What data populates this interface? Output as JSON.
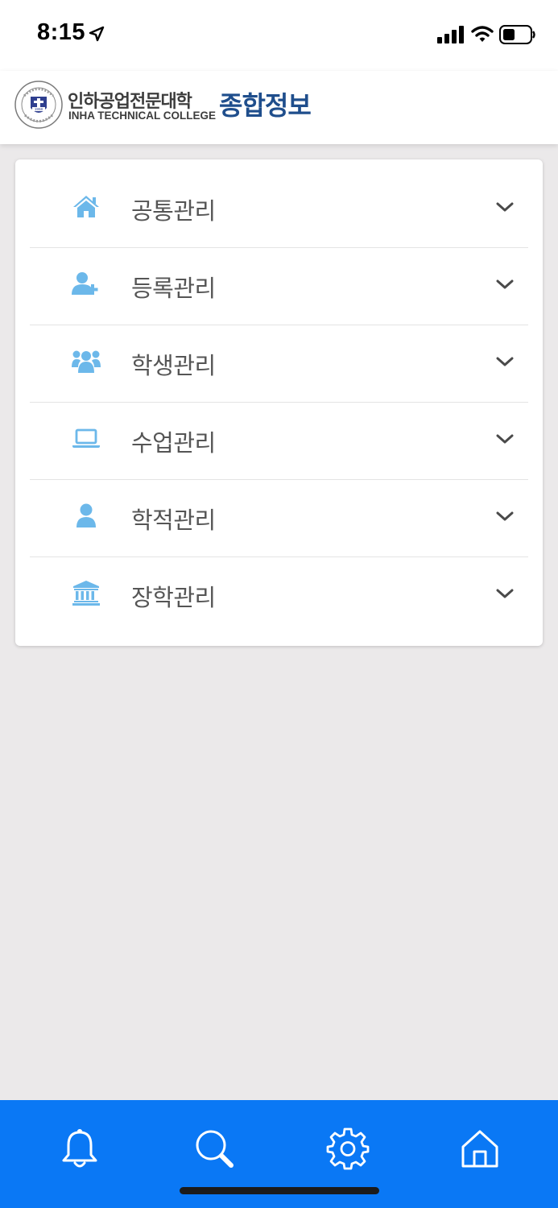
{
  "status_bar": {
    "time": "8:15",
    "icons": [
      "location-arrow-icon",
      "signal-icon",
      "wifi-icon",
      "battery-icon"
    ]
  },
  "header": {
    "logo_korean": "인하공업전문대학",
    "logo_english": "INHA TECHNICAL COLLEGE",
    "emblem_year": "1958",
    "title": "종합정보"
  },
  "menu": {
    "items": [
      {
        "label": "공통관리",
        "icon": "home-icon"
      },
      {
        "label": "등록관리",
        "icon": "user-plus-icon"
      },
      {
        "label": "학생관리",
        "icon": "users-icon"
      },
      {
        "label": "수업관리",
        "icon": "laptop-icon"
      },
      {
        "label": "학적관리",
        "icon": "user-icon"
      },
      {
        "label": "장학관리",
        "icon": "institution-icon"
      }
    ]
  },
  "bottom_nav": {
    "items": [
      "bell-icon",
      "search-icon",
      "gear-icon",
      "home-icon"
    ]
  },
  "colors": {
    "brand_title": "#1f4e8c",
    "icon_blue": "#6cb8ea",
    "nav_background": "#0a78f5",
    "page_background": "#ebe9ea"
  }
}
